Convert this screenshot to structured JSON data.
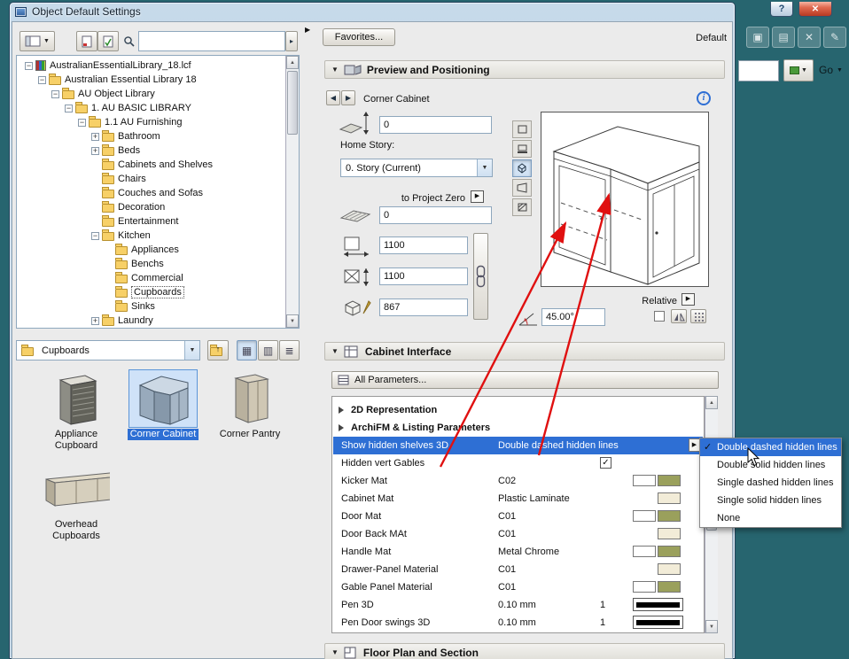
{
  "colors": {
    "accent_blue": "#2e6fd4",
    "arrow_red": "#e01010",
    "swatch_olive": "#9aa05c",
    "swatch_cream": "#f2ecd8",
    "swatch_white": "#ffffff",
    "teal_background": "#27656f"
  },
  "window": {
    "title": "Object Default Settings",
    "help_button": "?",
    "close_glyph": "✕"
  },
  "background_toolbar": {
    "icons": [
      "copy-icon",
      "clipboard-icon",
      "delete-icon",
      "edit-icon"
    ],
    "go_label": "Go"
  },
  "left_panel": {
    "folder_dropdown_value": "Cupboards",
    "tree": [
      {
        "label": "AustralianEssentialLibrary_18.lcf",
        "level": 0,
        "icon": "library",
        "expand": "minus"
      },
      {
        "label": "Australian Essential Library 18",
        "level": 1,
        "icon": "folder",
        "expand": "minus"
      },
      {
        "label": "AU Object Library",
        "level": 2,
        "icon": "folder",
        "expand": "minus"
      },
      {
        "label": "1. AU BASIC LIBRARY",
        "level": 3,
        "icon": "folder",
        "expand": "minus"
      },
      {
        "label": "1.1 AU Furnishing",
        "level": 4,
        "icon": "folder",
        "expand": "minus"
      },
      {
        "label": "Bathroom",
        "level": 5,
        "icon": "folder",
        "expand": "plus"
      },
      {
        "label": "Beds",
        "level": 5,
        "icon": "folder",
        "expand": "plus"
      },
      {
        "label": "Cabinets and Shelves",
        "level": 5,
        "icon": "folder",
        "expand": "none"
      },
      {
        "label": "Chairs",
        "level": 5,
        "icon": "folder",
        "expand": "none"
      },
      {
        "label": "Couches and Sofas",
        "level": 5,
        "icon": "folder",
        "expand": "none"
      },
      {
        "label": "Decoration",
        "level": 5,
        "icon": "folder",
        "expand": "none"
      },
      {
        "label": "Entertainment",
        "level": 5,
        "icon": "folder",
        "expand": "none"
      },
      {
        "label": "Kitchen",
        "level": 5,
        "icon": "folder",
        "expand": "minus"
      },
      {
        "label": "Appliances",
        "level": 6,
        "icon": "folder",
        "expand": "none"
      },
      {
        "label": "Benchs",
        "level": 6,
        "icon": "folder",
        "expand": "none"
      },
      {
        "label": "Commercial",
        "level": 6,
        "icon": "folder",
        "expand": "none"
      },
      {
        "label": "Cupboards",
        "level": 6,
        "icon": "folder",
        "expand": "none",
        "selected": true
      },
      {
        "label": "Sinks",
        "level": 6,
        "icon": "folder",
        "expand": "none"
      },
      {
        "label": "Laundry",
        "level": 5,
        "icon": "folder",
        "expand": "plus"
      }
    ],
    "thumbnails": [
      {
        "label": "Appliance Cupboard",
        "art": "appliance",
        "selected": false
      },
      {
        "label": "Corner Cabinet",
        "art": "corner-cabinet",
        "selected": true
      },
      {
        "label": "Corner Pantry",
        "art": "corner-pantry",
        "selected": false
      },
      {
        "label": "Overhead Cupboards",
        "art": "overhead",
        "selected": false
      }
    ]
  },
  "right_panel": {
    "favorites_button": "Favorites...",
    "default_label": "Default",
    "sections": {
      "preview": "Preview and Positioning",
      "cabinet_interface": "Cabinet Interface",
      "floor_plan": "Floor Plan and Section"
    },
    "preview": {
      "object_name": "Corner Cabinet",
      "story_elevation": "0",
      "home_story_label": "Home Story:",
      "home_story_value": "0. Story (Current)",
      "to_project_zero_label": "to Project Zero",
      "project_zero_offset": "0",
      "dim_x": "1100",
      "dim_y": "1100",
      "dim_z": "867",
      "relative_label": "Relative",
      "angle_value": "45.00°"
    },
    "all_parameters_button": "All Parameters...",
    "parameters": [
      {
        "type": "group",
        "name": "2D Representation"
      },
      {
        "type": "group",
        "name": "ArchiFM & Listing Parameters"
      },
      {
        "type": "dropdown",
        "name": "Show hidden shelves 3D",
        "value": "Double dashed hidden lines",
        "selected": true
      },
      {
        "type": "checkbox",
        "name": "Hidden vert Gables",
        "checked": true
      },
      {
        "type": "material2",
        "name": "Kicker Mat",
        "value": "C02"
      },
      {
        "type": "material1",
        "name": "Cabinet Mat",
        "value": "Plastic Laminate"
      },
      {
        "type": "material2",
        "name": "Door Mat",
        "value": "C01"
      },
      {
        "type": "material1",
        "name": "Door Back MAt",
        "value": "C01"
      },
      {
        "type": "material2",
        "name": "Handle Mat",
        "value": "Metal Chrome"
      },
      {
        "type": "material1",
        "name": "Drawer-Panel Material",
        "value": "C01"
      },
      {
        "type": "material2",
        "name": "Gable Panel Material",
        "value": "C01"
      },
      {
        "type": "pen",
        "name": "Pen 3D",
        "value": "0.10 mm",
        "pen_number": "1"
      },
      {
        "type": "pen",
        "name": "Pen Door swings 3D",
        "value": "0.10 mm",
        "pen_number": "1"
      }
    ]
  },
  "context_menu": {
    "options": [
      {
        "label": "Double dashed hidden lines",
        "checked": true,
        "highlighted": true
      },
      {
        "label": "Double solid hidden lines"
      },
      {
        "label": "Single dashed hidden lines"
      },
      {
        "label": "Single solid hidden lines"
      },
      {
        "label": "None"
      }
    ]
  }
}
